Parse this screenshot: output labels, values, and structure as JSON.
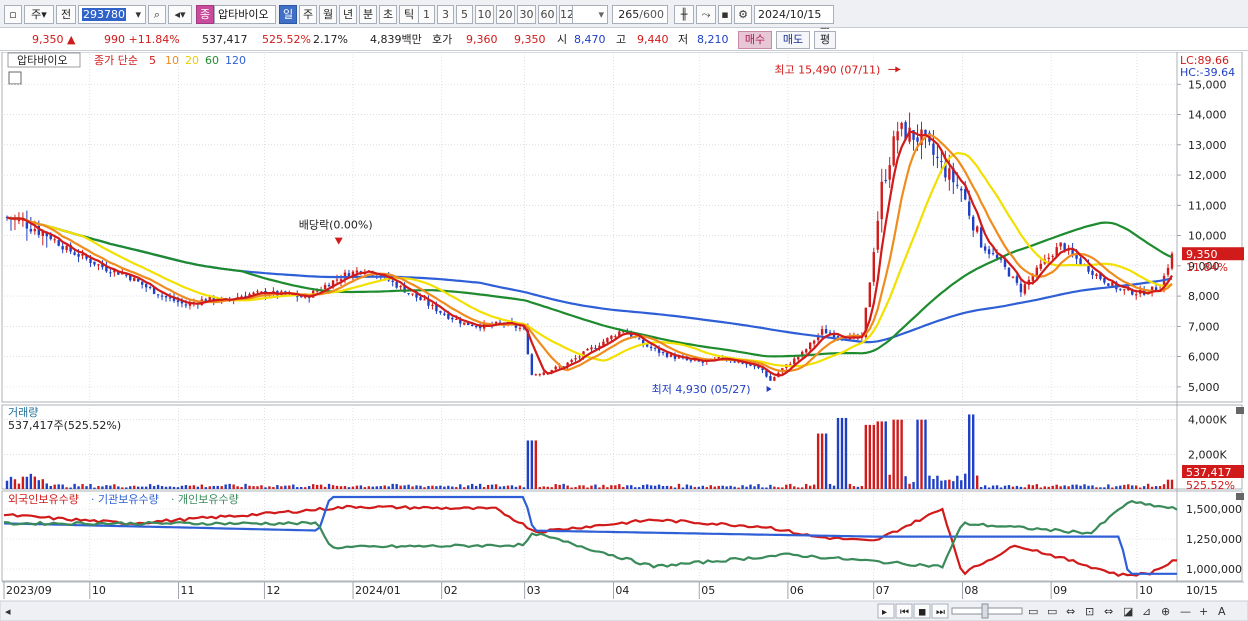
{
  "toolbar": {
    "period_type": "주",
    "prev_label": "전",
    "stock_code": "293780",
    "stock_tag": "종",
    "stock_name": "압타바이오",
    "timeframes": [
      "일",
      "주",
      "월",
      "년",
      "분",
      "초",
      "틱"
    ],
    "active_timeframe": "일",
    "intervals": [
      "1",
      "3",
      "5",
      "10",
      "20",
      "30",
      "60",
      "120"
    ],
    "count_value": "265",
    "count_max": "/600",
    "date": "2024/10/15"
  },
  "quote": {
    "price": "9,350",
    "up_mark": "▲",
    "change": "990",
    "change_pct": "+11.84%",
    "volume": "537,417",
    "volume_ratio": "525.52%",
    "turnover": "2.17%",
    "amount": "4,839백만",
    "ask_label": "호가",
    "ask_value": "9,360",
    "bid_value": "9,350",
    "open_label": "시",
    "open_value": "8,470",
    "high_label": "고",
    "high_value": "9,440",
    "low_label": "저",
    "low_value": "8,210",
    "buy_label": "매수",
    "sell_label": "매도",
    "eval_label": "평"
  },
  "legend": {
    "name": "압타바이오",
    "ma_label": "종가 단순",
    "ma_periods": [
      "5",
      "10",
      "20",
      "60",
      "120"
    ]
  },
  "colors": {
    "up": "#d11a1a",
    "down": "#1f3fc4",
    "ma5": "#d11a1a",
    "ma10": "#f08c1e",
    "ma20": "#f2e000",
    "ma60": "#1e8b2e",
    "ma120": "#2f5fd6",
    "foreign": "#d11a1a",
    "institution": "#2f5fd6",
    "individual": "#3a8a5a"
  },
  "chart_data": [
    {
      "type": "candlestick",
      "title": "압타바이오",
      "y_ticks": [
        "15,000",
        "14,000",
        "13,000",
        "12,000",
        "11,000",
        "10,000",
        "9,000",
        "8,000",
        "7,000",
        "6,000",
        "5,000"
      ],
      "ylim": [
        4500,
        16000
      ],
      "lc_label": "LC:89.66",
      "hc_label": "HC:-39.64",
      "current_price_label": "9,350",
      "current_pct_label": "11.84%",
      "annotations": {
        "high": "최고 15,490 (07/11)",
        "low": "최저 4,930 (05/27)",
        "dividend": "배당락(0.00%)"
      },
      "close_path": [
        [
          "2023-09-01",
          10600
        ],
        [
          "2023-09-08",
          10400
        ],
        [
          "2023-09-15",
          10050
        ],
        [
          "2023-09-22",
          9550
        ],
        [
          "2023-10-06",
          8900
        ],
        [
          "2023-10-13",
          8700
        ],
        [
          "2023-10-20",
          8300
        ],
        [
          "2023-10-27",
          7950
        ],
        [
          "2023-11-03",
          7700
        ],
        [
          "2023-11-10",
          7900
        ],
        [
          "2023-11-17",
          7850
        ],
        [
          "2023-11-24",
          8050
        ],
        [
          "2023-12-01",
          8100
        ],
        [
          "2023-12-08",
          8050
        ],
        [
          "2023-12-15",
          7950
        ],
        [
          "2023-12-22",
          8350
        ],
        [
          "2023-12-29",
          8700
        ],
        [
          "2024-01-05",
          8900
        ],
        [
          "2024-01-12",
          8600
        ],
        [
          "2024-01-19",
          8200
        ],
        [
          "2024-01-26",
          7800
        ],
        [
          "2024-02-02",
          7400
        ],
        [
          "2024-02-09",
          7100
        ],
        [
          "2024-02-16",
          7000
        ],
        [
          "2024-02-23",
          7100
        ],
        [
          "2024-03-01",
          6900
        ],
        [
          "2024-03-04",
          5400
        ],
        [
          "2024-03-08",
          5500
        ],
        [
          "2024-03-15",
          5700
        ],
        [
          "2024-03-22",
          6100
        ],
        [
          "2024-03-29",
          6500
        ],
        [
          "2024-04-05",
          6900
        ],
        [
          "2024-04-12",
          6400
        ],
        [
          "2024-04-19",
          6100
        ],
        [
          "2024-04-26",
          5900
        ],
        [
          "2024-05-03",
          5800
        ],
        [
          "2024-05-10",
          5950
        ],
        [
          "2024-05-17",
          5800
        ],
        [
          "2024-05-24",
          5550
        ],
        [
          "2024-05-27",
          5200
        ],
        [
          "2024-05-31",
          5600
        ],
        [
          "2024-06-07",
          6100
        ],
        [
          "2024-06-14",
          6850
        ],
        [
          "2024-06-21",
          6650
        ],
        [
          "2024-06-28",
          6600
        ],
        [
          "2024-07-01",
          8500
        ],
        [
          "2024-07-05",
          11600
        ],
        [
          "2024-07-11",
          13500
        ],
        [
          "2024-07-19",
          13200
        ],
        [
          "2024-07-26",
          12300
        ],
        [
          "2024-08-02",
          11500
        ],
        [
          "2024-08-09",
          9700
        ],
        [
          "2024-08-16",
          9100
        ],
        [
          "2024-08-23",
          8200
        ],
        [
          "2024-08-30",
          9000
        ],
        [
          "2024-09-06",
          9700
        ],
        [
          "2024-09-13",
          9100
        ],
        [
          "2024-09-20",
          8600
        ],
        [
          "2024-09-27",
          8200
        ],
        [
          "2024-10-04",
          8100
        ],
        [
          "2024-10-11",
          8300
        ],
        [
          "2024-10-15",
          9350
        ]
      ]
    },
    {
      "type": "bar",
      "title": "거래량",
      "summary": "537,417주(525.52%)",
      "y_ticks": [
        "4,000K",
        "2,000K"
      ],
      "ylim": [
        0,
        4500000
      ],
      "current_label": "537,417",
      "current_pct": "525.52%",
      "notable_values": [
        [
          "2024-03-04",
          2800000
        ],
        [
          "2024-06-14",
          3200000
        ],
        [
          "2024-06-21",
          4100000
        ],
        [
          "2024-07-01",
          3700000
        ],
        [
          "2024-07-05",
          3900000
        ],
        [
          "2024-07-11",
          4000000
        ],
        [
          "2024-07-19",
          4000000
        ],
        [
          "2024-08-05",
          4300000
        ],
        [
          "2024-10-15",
          537417
        ]
      ]
    },
    {
      "type": "line",
      "title": "보유수량",
      "series_names": [
        "외국인보유수량",
        "기관보유수량",
        "개인보유수량"
      ],
      "y_ticks": [
        "1,500,000",
        "1,250,000",
        "1,000,000"
      ],
      "ylim": [
        900000,
        1650000
      ],
      "series": [
        {
          "name": "외국인보유수량",
          "points": [
            [
              "2023-09-01",
              1450000
            ],
            [
              "2023-10-15",
              1380000
            ],
            [
              "2023-12-01",
              1460000
            ],
            [
              "2024-01-01",
              1520000
            ],
            [
              "2024-02-20",
              1500000
            ],
            [
              "2024-03-05",
              1310000
            ],
            [
              "2024-04-15",
              1410000
            ],
            [
              "2024-05-25",
              1350000
            ],
            [
              "2024-06-10",
              1270000
            ],
            [
              "2024-07-01",
              1230000
            ],
            [
              "2024-07-25",
              1500000
            ],
            [
              "2024-08-01",
              960000
            ],
            [
              "2024-08-20",
              1200000
            ],
            [
              "2024-09-25",
              950000
            ],
            [
              "2024-10-05",
              960000
            ],
            [
              "2024-10-15",
              1080000
            ]
          ]
        },
        {
          "name": "기관보유수량",
          "points": [
            [
              "2023-09-01",
              1380000
            ],
            [
              "2023-12-20",
              1320000
            ],
            [
              "2023-12-24",
              1600000
            ],
            [
              "2024-03-01",
              1600000
            ],
            [
              "2024-03-04",
              1320000
            ],
            [
              "2024-07-01",
              1270000
            ],
            [
              "2024-09-25",
              1270000
            ],
            [
              "2024-09-28",
              960000
            ],
            [
              "2024-10-15",
              960000
            ]
          ]
        },
        {
          "name": "개인보유수량",
          "points": [
            [
              "2023-09-01",
              1380000
            ],
            [
              "2023-12-20",
              1380000
            ],
            [
              "2023-12-24",
              1180000
            ],
            [
              "2024-03-01",
              1200000
            ],
            [
              "2024-03-04",
              1300000
            ],
            [
              "2024-04-15",
              1020000
            ],
            [
              "2024-06-01",
              1120000
            ],
            [
              "2024-07-25",
              1020000
            ],
            [
              "2024-08-01",
              1380000
            ],
            [
              "2024-09-15",
              1300000
            ],
            [
              "2024-09-28",
              1560000
            ],
            [
              "2024-10-15",
              1500000
            ]
          ]
        }
      ]
    }
  ],
  "x_axis": {
    "labels": [
      "2023/09",
      "10",
      "11",
      "12",
      "2024/01",
      "02",
      "03",
      "04",
      "05",
      "06",
      "07",
      "08",
      "09",
      "10"
    ],
    "corner_label": "10/15"
  }
}
